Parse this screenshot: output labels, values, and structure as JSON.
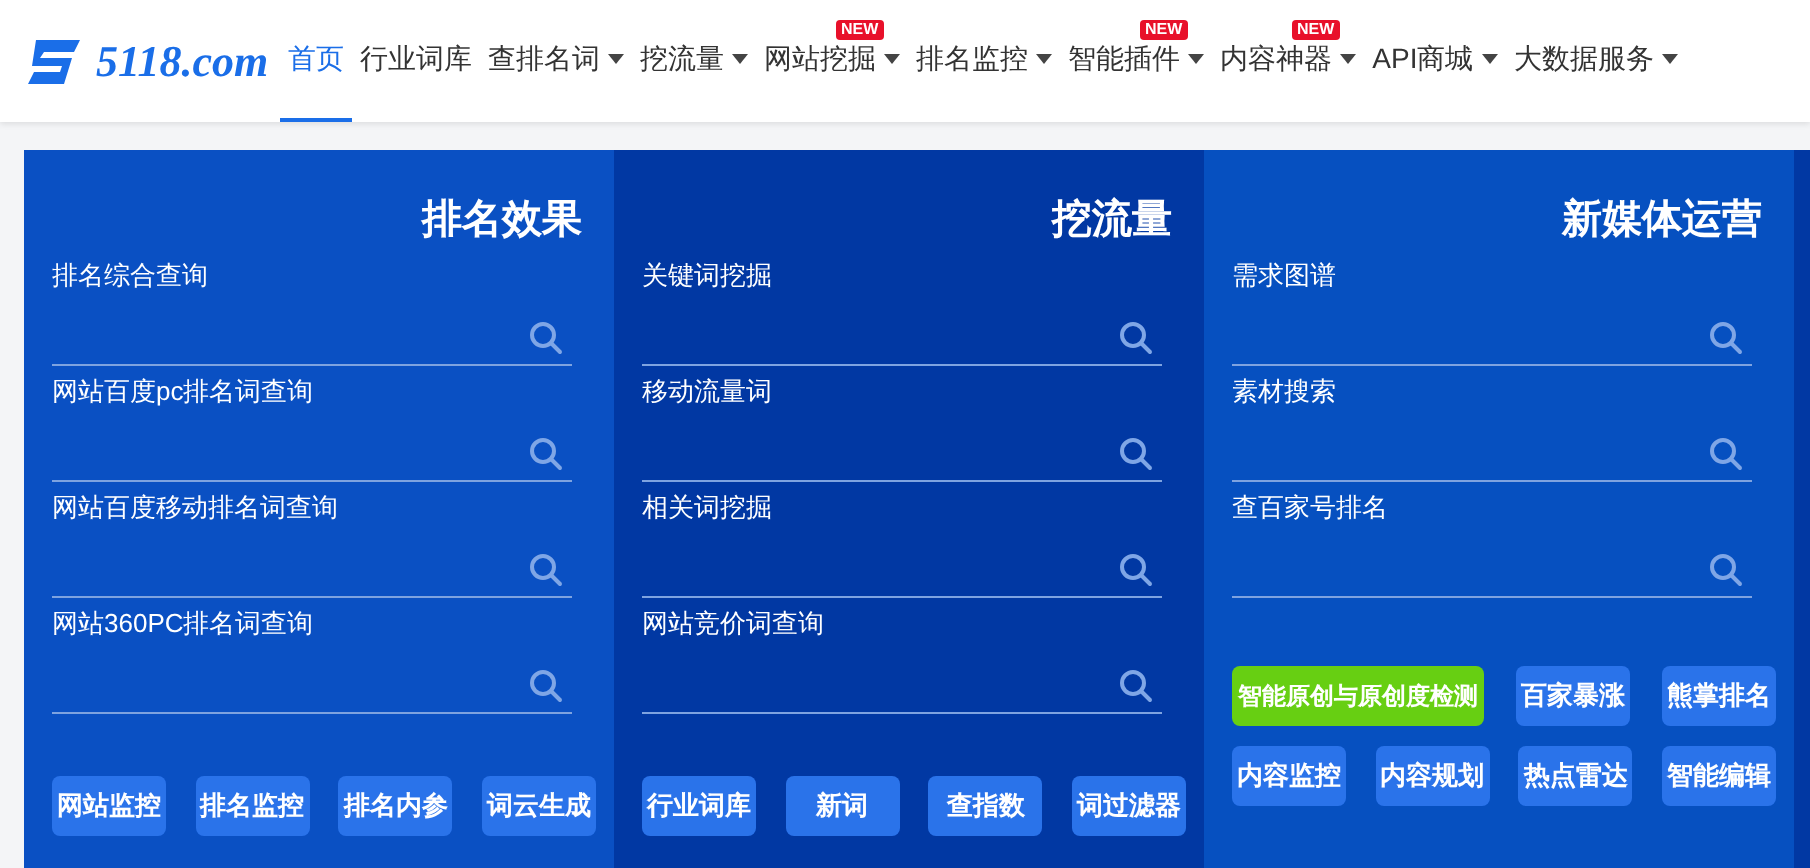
{
  "logo": {
    "text": "5118.com"
  },
  "nav": [
    {
      "label": "首页",
      "selected": true,
      "dropdown": false
    },
    {
      "label": "行业词库",
      "selected": false,
      "dropdown": false
    },
    {
      "label": "查排名词",
      "selected": false,
      "dropdown": true
    },
    {
      "label": "挖流量",
      "selected": false,
      "dropdown": true
    },
    {
      "label": "网站挖掘",
      "selected": false,
      "dropdown": true,
      "badge": "NEW"
    },
    {
      "label": "排名监控",
      "selected": false,
      "dropdown": true
    },
    {
      "label": "智能插件",
      "selected": false,
      "dropdown": true,
      "badge": "NEW"
    },
    {
      "label": "内容神器",
      "selected": false,
      "dropdown": true,
      "badge": "NEW"
    },
    {
      "label": "API商城",
      "selected": false,
      "dropdown": true
    },
    {
      "label": "大数据服务",
      "selected": false,
      "dropdown": true
    }
  ],
  "panels": [
    {
      "title": "排名效果",
      "color": "#0a50c3",
      "fields": [
        {
          "label": "排名综合查询"
        },
        {
          "label": "网站百度pc排名词查询"
        },
        {
          "label": "网站百度移动排名词查询"
        },
        {
          "label": "网站360PC排名词查询"
        }
      ],
      "buttons": [
        {
          "label": "网站监控",
          "highlighted": false
        },
        {
          "label": "排名监控",
          "highlighted": false
        },
        {
          "label": "排名内参",
          "highlighted": false
        },
        {
          "label": "词云生成",
          "highlighted": false
        }
      ]
    },
    {
      "title": "挖流量",
      "color": "#0138a3",
      "fields": [
        {
          "label": "关键词挖掘"
        },
        {
          "label": "移动流量词"
        },
        {
          "label": "相关词挖掘"
        },
        {
          "label": "网站竞价词查询"
        }
      ],
      "buttons": [
        {
          "label": "行业词库",
          "highlighted": false
        },
        {
          "label": "新词",
          "highlighted": false
        },
        {
          "label": "查指数",
          "highlighted": false
        },
        {
          "label": "词过滤器",
          "highlighted": false
        }
      ]
    },
    {
      "title": "新媒体运营",
      "color": "#0650c0",
      "fields": [
        {
          "label": "需求图谱"
        },
        {
          "label": "素材搜索"
        },
        {
          "label": "查百家号排名"
        }
      ],
      "buttons": [
        {
          "label": "智能原创与原创度检测",
          "highlighted": true
        },
        {
          "label": "百家暴涨",
          "highlighted": false
        },
        {
          "label": "熊掌排名",
          "highlighted": false
        },
        {
          "label": "内容监控",
          "highlighted": false
        },
        {
          "label": "内容规划",
          "highlighted": false
        },
        {
          "label": "热点雷达",
          "highlighted": false
        },
        {
          "label": "智能编辑",
          "highlighted": false
        }
      ]
    }
  ]
}
